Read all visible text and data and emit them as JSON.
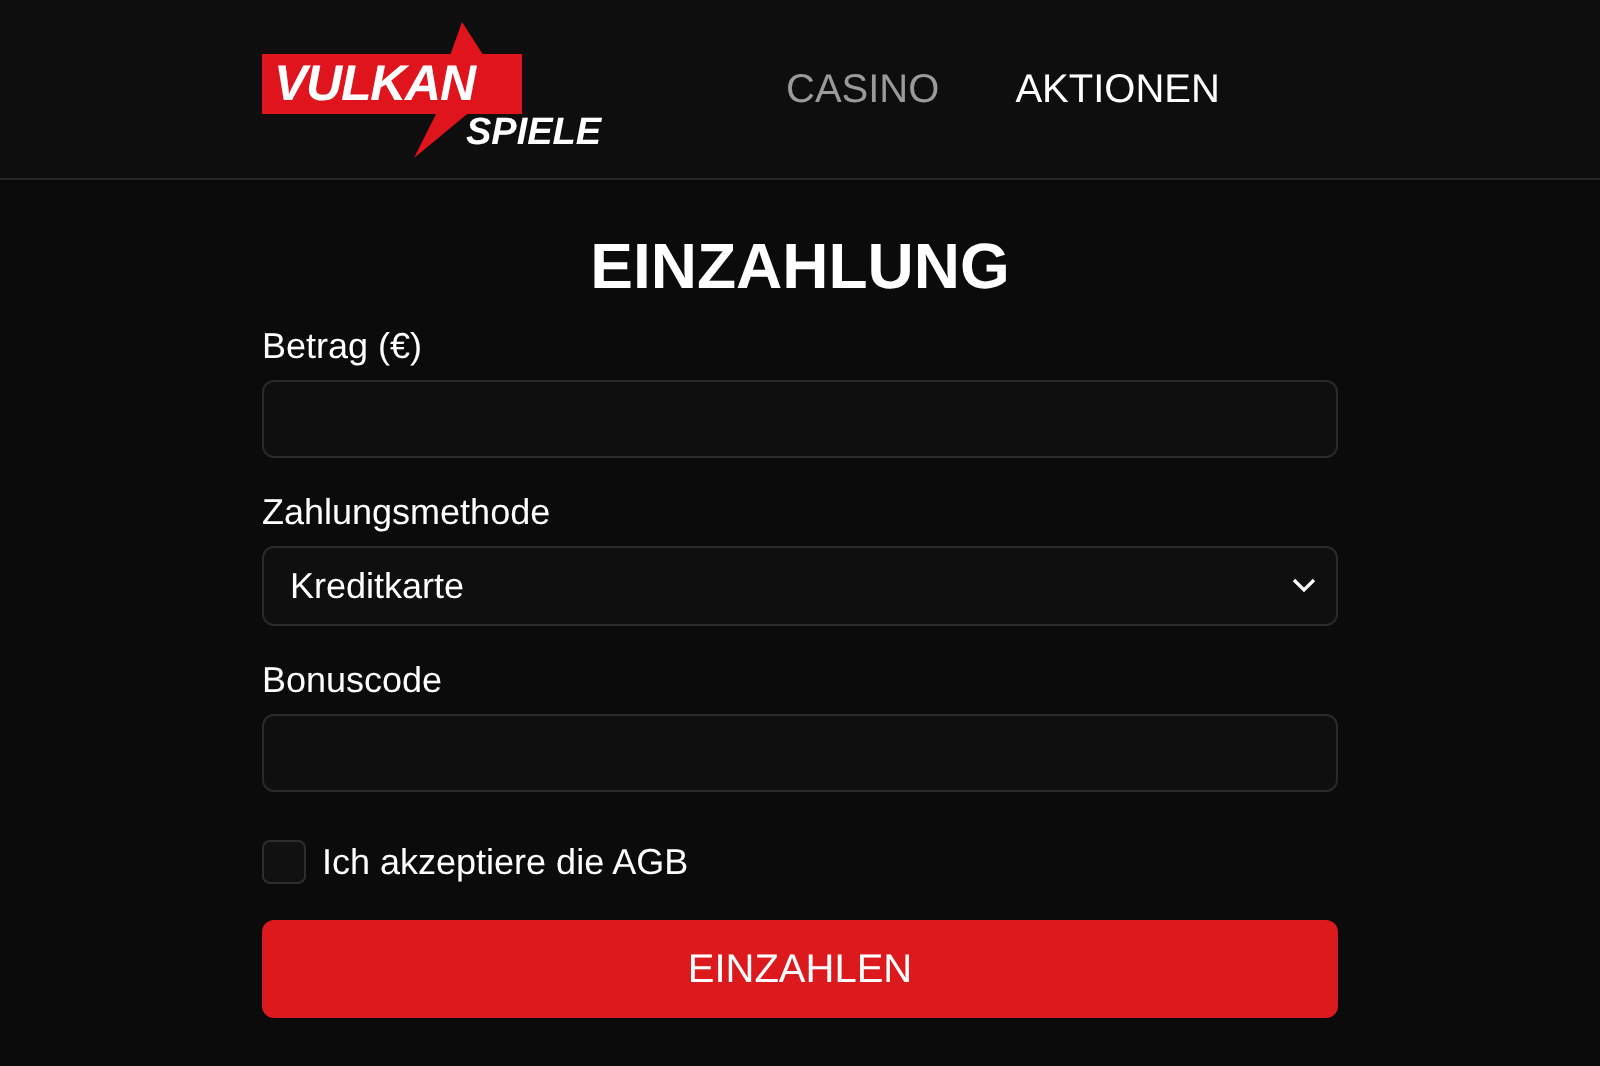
{
  "header": {
    "logo": {
      "word": "VULKAN",
      "subword": "SPIELE"
    },
    "nav": [
      {
        "label": "CASINO",
        "selected": false
      },
      {
        "label": "AKTIONEN",
        "selected": true
      }
    ]
  },
  "form": {
    "title": "EINZAHLUNG",
    "fields": [
      {
        "kind": "input",
        "label": "Betrag (€)"
      },
      {
        "kind": "select",
        "label": "Zahlungsmethode",
        "value": "Kreditkarte"
      },
      {
        "kind": "input",
        "label": "Bonuscode"
      }
    ],
    "terms": {
      "label": "Ich akzeptiere die AGB",
      "checked": false
    },
    "submit": "EINZAHLEN"
  }
}
